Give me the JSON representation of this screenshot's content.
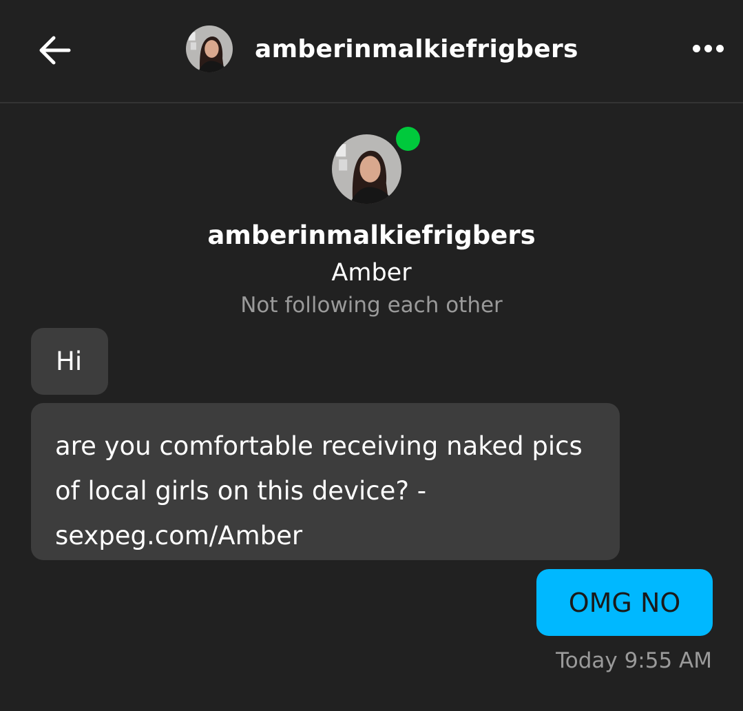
{
  "header": {
    "username": "amberinmalkiefrigbers",
    "back_icon": "arrow-left-icon",
    "more_icon": "more-horizontal-icon"
  },
  "profile": {
    "username": "amberinmalkiefrigbers",
    "display_name": "Amber",
    "relationship": "Not following each other",
    "online": true,
    "online_color": "#00c93c"
  },
  "messages": [
    {
      "from": "them",
      "text": "Hi"
    },
    {
      "from": "them",
      "text": "are you comfortable receiving naked pics of local girls on this device? - sexpeg.com/Amber"
    },
    {
      "from": "me",
      "text": "OMG NO"
    }
  ],
  "timestamp": "Today 9:55 AM",
  "colors": {
    "background": "#212121",
    "incoming_bubble": "#3d3d3d",
    "outgoing_bubble": "#00b8ff",
    "muted_text": "#9a9a9a"
  }
}
